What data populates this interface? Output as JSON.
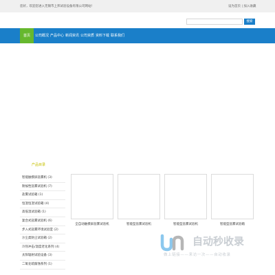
{
  "topbar": {
    "welcome": "您好，欢迎您进入无锡市上邦试验设备有限公司网站！",
    "set_home": "设为首页",
    "separator": "|",
    "add_favorite": "加入收藏"
  },
  "search": {
    "placeholder": "",
    "button_label": "搜索"
  },
  "nav": {
    "items": [
      "首页",
      "公司概况",
      "产品中心",
      "新闻资讯",
      "公司资质",
      "资料下载",
      "联系我们"
    ]
  },
  "categories": {
    "title": "产品目录",
    "items": [
      "智能触摸屏盐雾机 (3)",
      "耐候性盐雾试验机 (7)",
      "盐雾试验箱 (1)",
      "恒温恒湿试验箱 (4)",
      "高低温试验箱 (1)",
      "复合式盐雾试验机 (6)",
      "步入式盐雾环境试验室 (2)",
      "沙尘类防尘试验箱 (2)",
      "冷热冲击/温度老化系列 (4)",
      "太阳辐射试验设备 (3)",
      "二氧化硫腐蚀系列 (1)"
    ]
  },
  "products": [
    {
      "name": "全自动触摸屏盐雾试验机"
    },
    {
      "name": "智能型盐雾试验机"
    },
    {
      "name": "智能型盐雾试验机"
    },
    {
      "name": "智能型盐雾试验箱"
    }
  ],
  "watermark": {
    "text": "自动秒收录",
    "subtext": "做上链接——来访一次——自动收录"
  },
  "colors": {
    "nav_bg": "#1a7fc9",
    "nav_active": "#66b82e",
    "category_title": "#c6c100"
  }
}
